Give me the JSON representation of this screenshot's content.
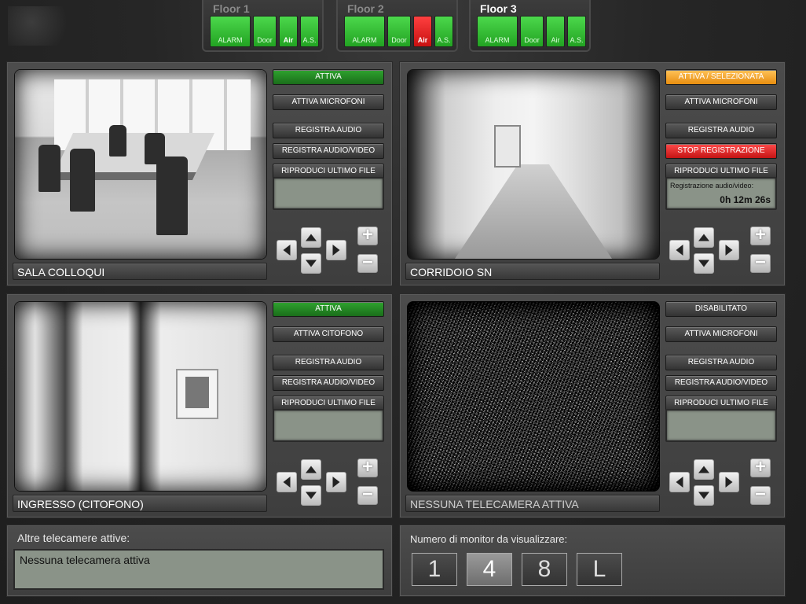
{
  "floors": [
    {
      "name": "Floor 1",
      "indicators": [
        {
          "label": "ALARM",
          "state": "green"
        },
        {
          "label": "Door",
          "state": "green"
        },
        {
          "label": "Air",
          "state": "green"
        },
        {
          "label": "A.S.",
          "state": "green"
        }
      ]
    },
    {
      "name": "Floor 2",
      "indicators": [
        {
          "label": "ALARM",
          "state": "green"
        },
        {
          "label": "Door",
          "state": "green"
        },
        {
          "label": "Air",
          "state": "red"
        },
        {
          "label": "A.S.",
          "state": "green"
        }
      ]
    },
    {
      "name": "Floor 3",
      "indicators": [
        {
          "label": "ALARM",
          "state": "green"
        },
        {
          "label": "Door",
          "state": "green"
        },
        {
          "label": "Air",
          "state": "green"
        },
        {
          "label": "A.S.",
          "state": "green"
        }
      ]
    }
  ],
  "cameras": [
    {
      "name": "SALA COLLOQUI",
      "buttons": {
        "activate": "ATTIVA",
        "secondary": "ATTIVA MICROFONI",
        "rec_audio": "REGISTRA AUDIO",
        "rec_av": "REGISTRA AUDIO/VIDEO",
        "play": "RIPRODUCI ULTIMO FILE"
      }
    },
    {
      "name": "CORRIDOIO SN",
      "buttons": {
        "activate": "ATTIVA / SELEZIONATA",
        "secondary": "ATTIVA MICROFONI",
        "rec_audio": "REGISTRA AUDIO",
        "rec_av": "STOP REGISTRAZIONE",
        "play": "RIPRODUCI ULTIMO FILE"
      },
      "recording": {
        "label": "Registrazione audio/video:",
        "time": "0h 12m 26s"
      }
    },
    {
      "name": "INGRESSO (CITOFONO)",
      "buttons": {
        "activate": "ATTIVA",
        "secondary": "ATTIVA CITOFONO",
        "rec_audio": "REGISTRA AUDIO",
        "rec_av": "REGISTRA AUDIO/VIDEO",
        "play": "RIPRODUCI ULTIMO FILE"
      }
    },
    {
      "name": "NESSUNA TELECAMERA ATTIVA",
      "buttons": {
        "activate": "DISABILITATO",
        "secondary": "ATTIVA MICROFONI",
        "rec_audio": "REGISTRA AUDIO",
        "rec_av": "REGISTRA AUDIO/VIDEO",
        "play": "RIPRODUCI ULTIMO FILE"
      }
    }
  ],
  "controls": {
    "zoom_in": "+",
    "zoom_out": "−"
  },
  "other_cameras": {
    "title": "Altre telecamere attive:",
    "value": "Nessuna telecamera attiva"
  },
  "monitors": {
    "title": "Numero di monitor da visualizzare:",
    "options": [
      "1",
      "4",
      "8",
      "L"
    ],
    "selected": "4"
  }
}
